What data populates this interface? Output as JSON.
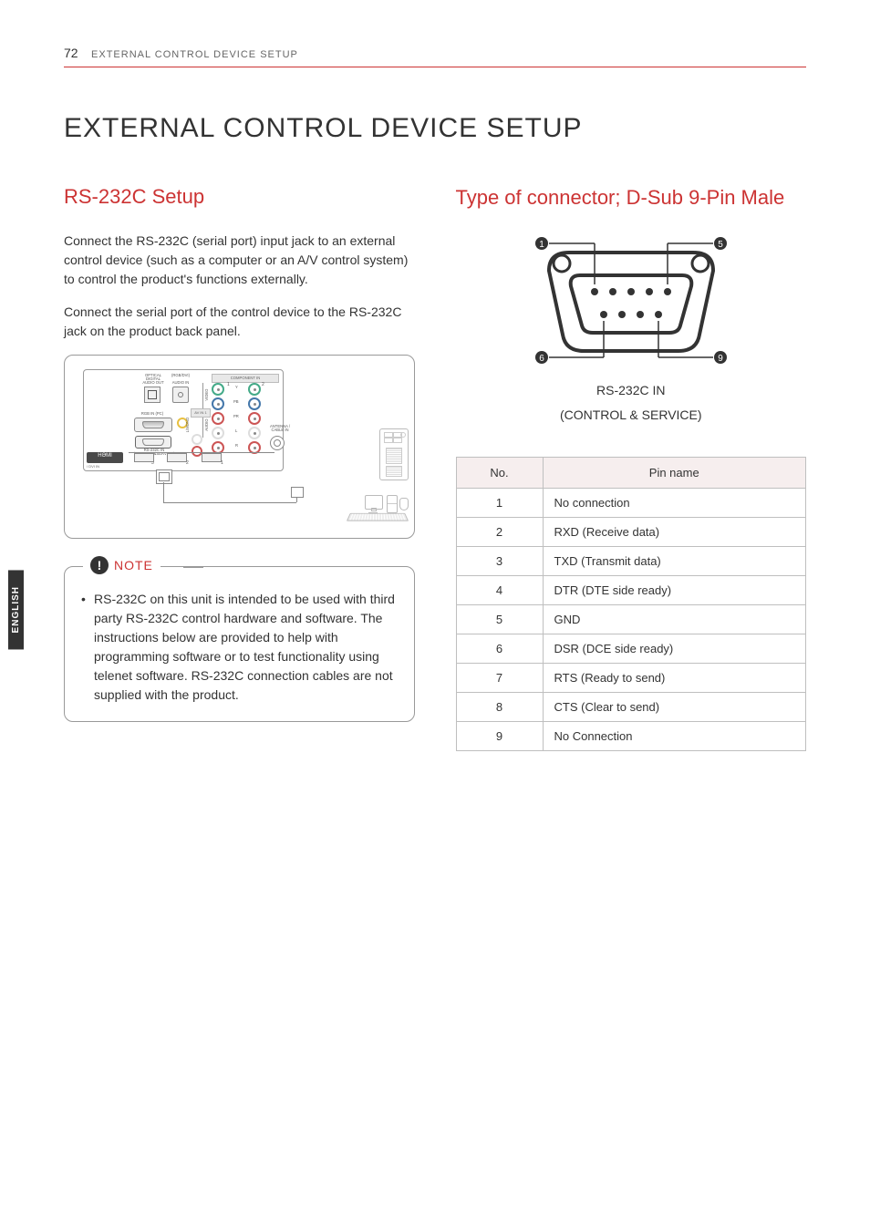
{
  "header": {
    "page_number": "72",
    "breadcrumb": "EXTERNAL CONTROL DEVICE SETUP"
  },
  "side_tab": "ENGLISH",
  "main_title": "EXTERNAL CONTROL DEVICE SETUP",
  "left": {
    "section_title": "RS-232C Setup",
    "para1": "Connect the RS-232C (serial port) input jack to an external control device (such as a computer or an A/V control system) to control the product's functions externally.",
    "para2": "Connect the serial port of the control device to the RS-232C jack on the product back panel.",
    "diagram_labels": {
      "optical": "OPTICAL DIGITAL",
      "audio_out": "AUDIO OUT",
      "rgb_audio": "(RGB/DVI)",
      "audio_in": "AUDIO IN",
      "component_in": "COMPONENT IN",
      "av_in": "AV IN 1",
      "rgb_in": "RGB IN (PC)",
      "rs232": "RS-232C IN (CONTROL&SERVICE)",
      "antenna": "ANTENNA / CABLE IN",
      "hdmi": "HƏMI",
      "dvi_in": "/ DVI IN",
      "video": "VIDEO",
      "audio": "AUDIO",
      "y": "Y",
      "pb": "PB",
      "pr": "PR",
      "l": "L",
      "r": "R",
      "n1": "1",
      "n2": "2",
      "n3": "3"
    },
    "note": {
      "label": "NOTE",
      "body": "RS-232C on this unit is intended to be used with third party RS-232C control hardware and software. The instructions below are provided to help with programming software or to test functionality using telenet software. RS-232C connection cables are not supplied with the product."
    }
  },
  "right": {
    "section_title": "Type of connector; D-Sub 9-Pin Male",
    "connector_caption_1": "RS-232C IN",
    "connector_caption_2": "(CONTROL & SERVICE)",
    "pin_markers": {
      "one": "1",
      "five": "5",
      "six": "6",
      "nine": "9"
    },
    "table": {
      "head_no": "No.",
      "head_pin": "Pin name",
      "rows": [
        {
          "no": "1",
          "name": "No connection"
        },
        {
          "no": "2",
          "name": "RXD (Receive data)"
        },
        {
          "no": "3",
          "name": "TXD (Transmit data)"
        },
        {
          "no": "4",
          "name": "DTR (DTE side ready)"
        },
        {
          "no": "5",
          "name": "GND"
        },
        {
          "no": "6",
          "name": "DSR (DCE side ready)"
        },
        {
          "no": "7",
          "name": "RTS (Ready to send)"
        },
        {
          "no": "8",
          "name": "CTS (Clear to send)"
        },
        {
          "no": "9",
          "name": "No Connection"
        }
      ]
    }
  }
}
